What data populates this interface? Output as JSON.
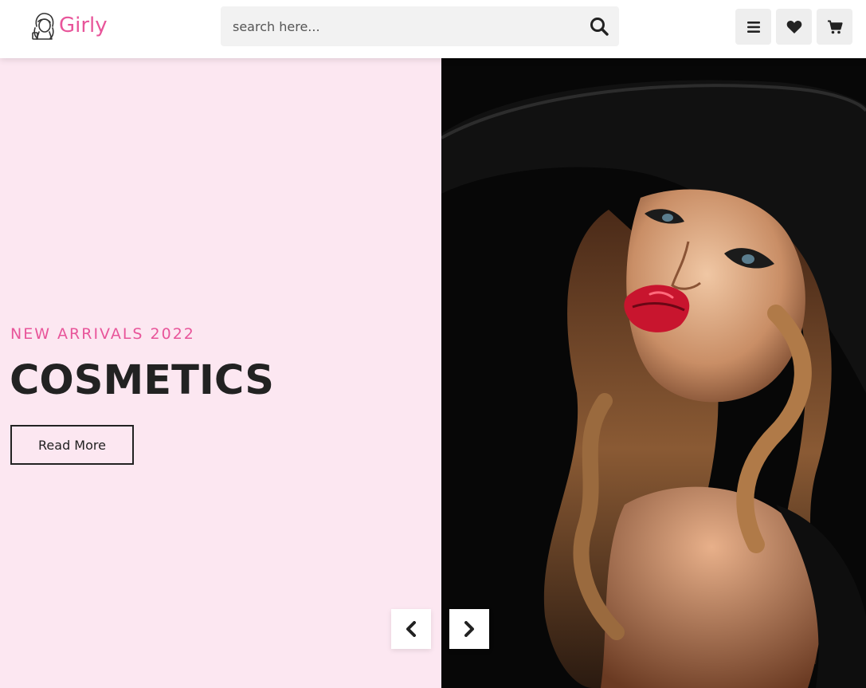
{
  "brand": {
    "name": "Girly",
    "accent": "#e8559a",
    "icon": "girl-logo-icon"
  },
  "search": {
    "placeholder": "search here...",
    "icon": "search-icon"
  },
  "header_icons": [
    {
      "name": "menu",
      "icon": "bars-icon"
    },
    {
      "name": "wishlist",
      "icon": "heart-icon"
    },
    {
      "name": "cart",
      "icon": "cart-icon"
    }
  ],
  "hero": {
    "eyebrow": "NEW ARRIVALS 2022",
    "headline": "COSMETICS",
    "cta": "Read More",
    "left_bg": "#fce7f1",
    "image": "woman-with-black-hat-red-lips-photo",
    "prev_icon": "chevron-left-icon",
    "next_icon": "chevron-right-icon"
  }
}
